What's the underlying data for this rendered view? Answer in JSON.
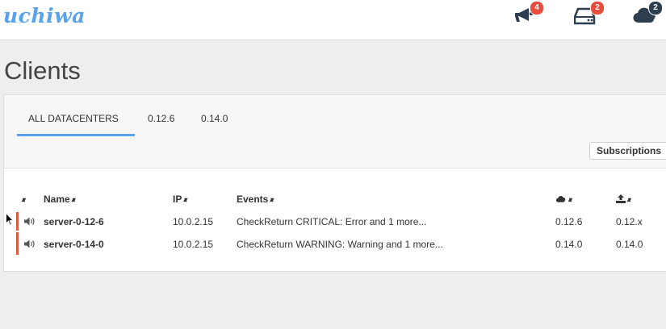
{
  "app": {
    "logo": "uchiwa"
  },
  "header": {
    "icons": [
      {
        "name": "megaphone-icon",
        "badge": "4",
        "badge_color": "#e74c3c"
      },
      {
        "name": "server-icon",
        "badge": "2",
        "badge_color": "#e74c3c"
      },
      {
        "name": "cloud-icon",
        "badge": "2",
        "badge_color": "#2c3e50"
      }
    ]
  },
  "page": {
    "title": "Clients"
  },
  "tabs": [
    {
      "label": "ALL DATACENTERS",
      "active": true
    },
    {
      "label": "0.12.6",
      "active": false
    },
    {
      "label": "0.14.0",
      "active": false
    }
  ],
  "toolbar": {
    "subscriptions_label": "Subscriptions"
  },
  "table": {
    "columns": {
      "name": "Name",
      "ip": "IP",
      "events": "Events",
      "datacenter_icon": "cloud-icon",
      "version_icon": "upload-icon"
    },
    "rows": [
      {
        "name": "server-0-12-6",
        "ip": "10.0.2.15",
        "events": "CheckReturn CRITICAL: Error and 1 more...",
        "datacenter": "0.12.6",
        "version": "0.12.x",
        "status_color": "#e05a3c"
      },
      {
        "name": "server-0-14-0",
        "ip": "10.0.2.15",
        "events": "CheckReturn WARNING: Warning and 1 more...",
        "datacenter": "0.14.0",
        "version": "0.14.0",
        "status_color": "#e05a3c"
      }
    ]
  },
  "colors": {
    "accent": "#5aa3ea",
    "critical": "#e05a3c"
  }
}
